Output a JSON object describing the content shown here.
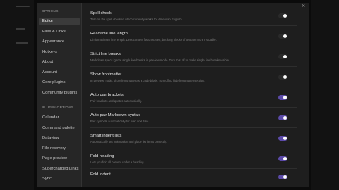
{
  "sidebar": {
    "options_title": "OPTIONS",
    "options_items": [
      {
        "label": "Editor"
      },
      {
        "label": "Files & Links"
      },
      {
        "label": "Appearance"
      },
      {
        "label": "Hotkeys"
      },
      {
        "label": "About"
      },
      {
        "label": "Account"
      },
      {
        "label": "Core plugins"
      },
      {
        "label": "Community plugins"
      }
    ],
    "plugin_title": "PLUGIN OPTIONS",
    "plugin_items": [
      {
        "label": "Calendar"
      },
      {
        "label": "Command palette"
      },
      {
        "label": "Dataview"
      },
      {
        "label": "File recovery"
      },
      {
        "label": "Page preview"
      },
      {
        "label": "Supercharged Links"
      },
      {
        "label": "Sync"
      }
    ],
    "active_item": "Editor"
  },
  "content": {
    "close_glyph": "×",
    "settings": [
      {
        "title": "Spell check",
        "desc": "Turn on the spell checker, which currently works for American English.",
        "enabled": false
      },
      {
        "title": "Readable line length",
        "desc": "Limit maximum line length. Less content fits onscreen, but long blocks of text are more readable.",
        "enabled": false
      },
      {
        "title": "Strict line breaks",
        "desc": "Markdown specs ignore single line breaks in preview mode. Turn this off to make single line breaks visible.",
        "enabled": false
      },
      {
        "title": "Show frontmatter",
        "desc": "In preview mode, show frontmatter as a code block. Turn off to hide frontmatter section.",
        "enabled": false
      },
      {
        "title": "Auto pair brackets",
        "desc": "Pair brackets and quotes automatically.",
        "enabled": true
      },
      {
        "title": "Auto pair Markdown syntax",
        "desc": "Pair symbols automatically for bold and italic.",
        "enabled": true
      },
      {
        "title": "Smart indent lists",
        "desc": "Automatically set indentation and place list items correctly.",
        "enabled": true
      },
      {
        "title": "Fold heading",
        "desc": "Lets you fold all content under a heading.",
        "enabled": true
      },
      {
        "title": "Fold indent",
        "desc": "",
        "enabled": true
      }
    ]
  },
  "colors": {
    "toggle_on": "#5b4aa8",
    "toggle_off": "#2a2a2a",
    "active_nav": "#3b3b3b"
  }
}
